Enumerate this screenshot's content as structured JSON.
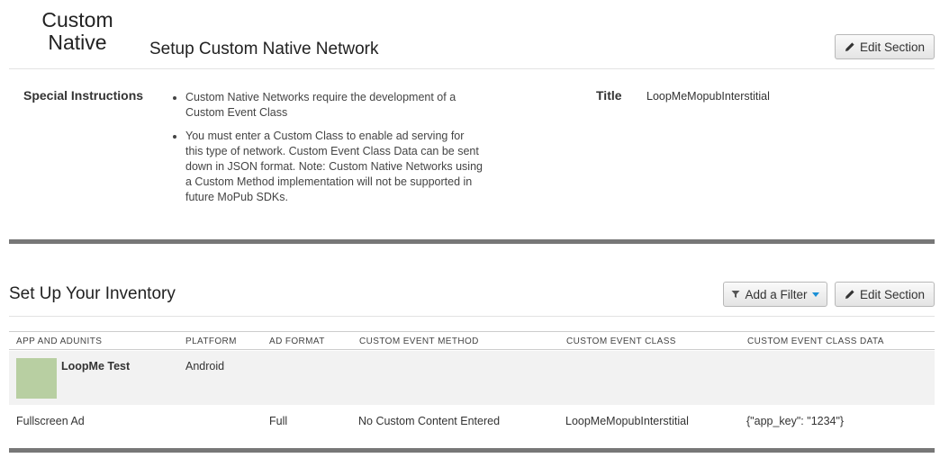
{
  "network": {
    "name_line1": "Custom",
    "name_line2": "Native"
  },
  "setup_section": {
    "heading": "Setup Custom Native Network",
    "edit_label": "Edit Section",
    "special_label": "Special Instructions",
    "instructions": [
      "Custom Native Networks require the development of a Custom Event Class",
      "You must enter a Custom Class to enable ad serving for this type of network. Custom Event Class Data can be sent down in JSON format. Note: Custom Native Networks using a Custom Method implementation will not be supported in future MoPub SDKs."
    ],
    "title_label": "Title",
    "title_value": "LoopMeMopubInterstitial"
  },
  "inventory": {
    "heading": "Set Up Your Inventory",
    "filter_label": "Add a Filter",
    "edit_label": "Edit Section",
    "columns": [
      "APP AND ADUNITS",
      "PLATFORM",
      "AD FORMAT",
      "CUSTOM EVENT METHOD",
      "CUSTOM EVENT CLASS",
      "CUSTOM EVENT CLASS DATA"
    ],
    "app": {
      "name": "LoopMe Test",
      "platform": "Android"
    },
    "adunit": {
      "name": "Fullscreen Ad",
      "format": "Full",
      "method": "No Custom Content Entered",
      "class": "LoopMeMopubInterstitial",
      "class_data": "{\"app_key\": \"1234\"}"
    }
  },
  "colors": {
    "thumb": "#b8cfa2",
    "divider": "#777777",
    "caret": "#1a8fd6"
  },
  "icons": [
    "pencil-icon",
    "filter-icon",
    "caret-down-icon"
  ]
}
